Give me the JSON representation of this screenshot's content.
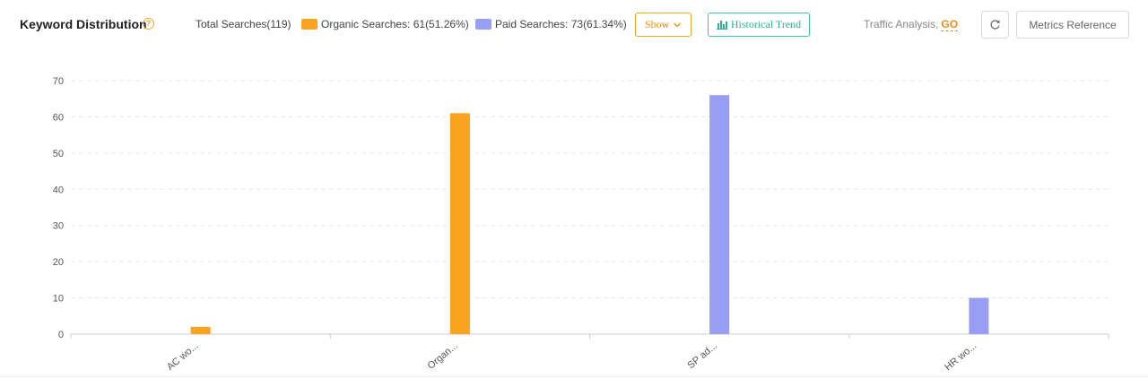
{
  "header": {
    "title": "Keyword Distribution",
    "total": "Total Searches(119)",
    "organic": "Organic Searches: 61(51.26%)",
    "paid": "Paid Searches: 73(61.34%)",
    "show_label": "Show",
    "historical_label": "Historical Trend",
    "traffic_label": "Traffic Analysis,",
    "go_label": "GO",
    "metrics_label": "Metrics Reference"
  },
  "colors": {
    "organic": "#f9a31f",
    "paid": "#979ef3",
    "grid": "#e8e8e8"
  },
  "chart_data": {
    "type": "bar",
    "categories": [
      "AC wo...",
      "Organ...",
      "SP ad...",
      "HR wo..."
    ],
    "series": [
      {
        "name": "Organic Searches",
        "values": [
          2,
          61,
          0,
          0
        ]
      },
      {
        "name": "Paid Searches",
        "values": [
          0,
          0,
          66,
          10
        ]
      }
    ],
    "ylim": [
      0,
      70
    ],
    "yticks": [
      0,
      10,
      20,
      30,
      40,
      50,
      60,
      70
    ],
    "grid": true,
    "title": "",
    "xlabel": "",
    "ylabel": ""
  }
}
